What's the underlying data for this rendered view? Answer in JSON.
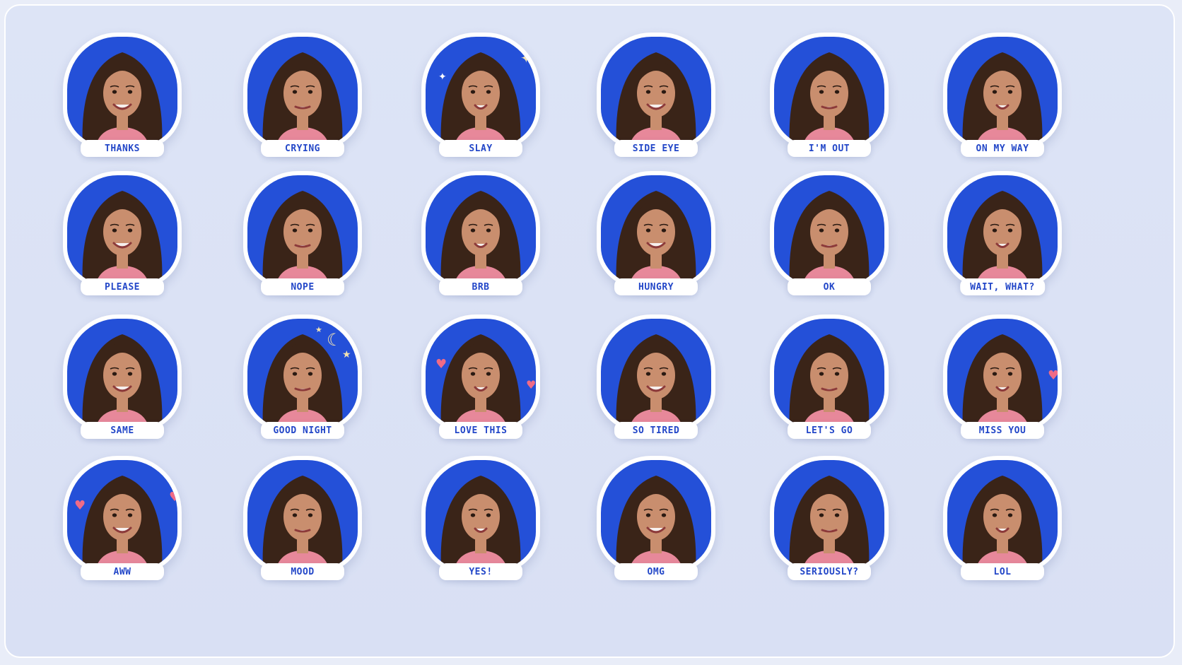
{
  "colors": {
    "background": "#dde4f6",
    "sticker_blue": "#2450d8",
    "label_text": "#2347c8",
    "hair": "#3a2418",
    "skin": "#c98e6e",
    "sweater": "#e7889a"
  },
  "stickers": [
    {
      "label": "THANKS",
      "icon": "smiling-face-sticker"
    },
    {
      "label": "CRYING",
      "icon": "crying-face-sticker"
    },
    {
      "label": "SLAY",
      "icon": "peace-sign-wink-sticker"
    },
    {
      "label": "SIDE EYE",
      "icon": "side-eye-face-sticker"
    },
    {
      "label": "I'M OUT",
      "icon": "waving-goodbye-sticker"
    },
    {
      "label": "ON MY WAY",
      "icon": "pointing-hand-sticker"
    },
    {
      "label": "PLEASE",
      "icon": "praying-hands-sticker"
    },
    {
      "label": "NOPE",
      "icon": "crossed-arms-sticker"
    },
    {
      "label": "BRB",
      "icon": "waving-hand-sticker"
    },
    {
      "label": "HUNGRY",
      "icon": "fork-thinking-sticker"
    },
    {
      "label": "OK",
      "icon": "ok-hand-wink-sticker"
    },
    {
      "label": "WAIT, WHAT?",
      "icon": "surprised-face-sticker"
    },
    {
      "label": "SAME",
      "icon": "grinning-face-sticker"
    },
    {
      "label": "GOOD NIGHT",
      "icon": "sleeping-moon-sticker"
    },
    {
      "label": "LOVE THIS",
      "icon": "heart-eyes-sticker"
    },
    {
      "label": "SO TIRED",
      "icon": "yawning-face-sticker"
    },
    {
      "label": "LET'S GO",
      "icon": "fist-pump-sticker"
    },
    {
      "label": "MISS YOU",
      "icon": "blowing-kiss-sticker"
    },
    {
      "label": "AWW",
      "icon": "cheeks-hearts-sticker"
    },
    {
      "label": "MOOD",
      "icon": "chin-rest-sticker"
    },
    {
      "label": "YES!",
      "icon": "thumbs-up-sticker"
    },
    {
      "label": "OMG",
      "icon": "gasp-face-sticker"
    },
    {
      "label": "SERIOUSLY?",
      "icon": "skeptical-face-sticker"
    },
    {
      "label": "LOL",
      "icon": "laughing-wink-sticker"
    }
  ]
}
